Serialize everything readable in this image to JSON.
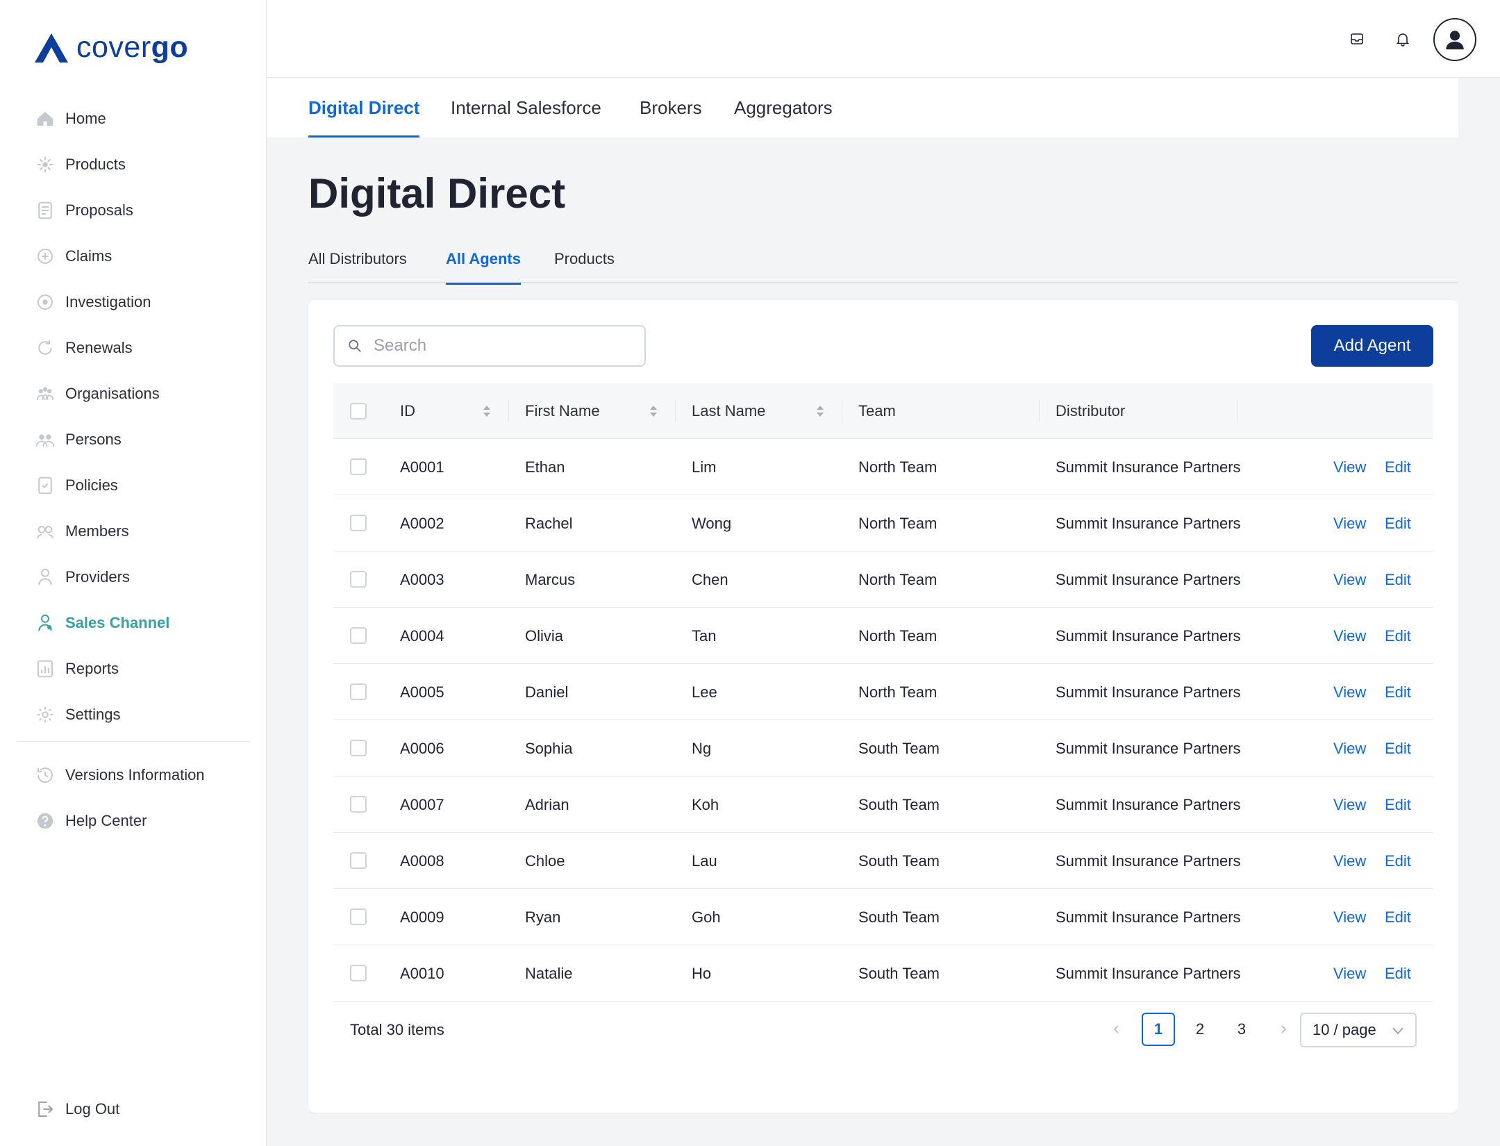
{
  "brand": {
    "name_light": "cover",
    "name_bold": "go"
  },
  "sidebar": {
    "items": [
      {
        "label": "Home",
        "icon": "home-icon"
      },
      {
        "label": "Products",
        "icon": "products-icon"
      },
      {
        "label": "Proposals",
        "icon": "proposals-icon"
      },
      {
        "label": "Claims",
        "icon": "claims-icon"
      },
      {
        "label": "Investigation",
        "icon": "investigation-icon"
      },
      {
        "label": "Renewals",
        "icon": "renewals-icon"
      },
      {
        "label": "Organisations",
        "icon": "organisations-icon"
      },
      {
        "label": "Persons",
        "icon": "persons-icon"
      },
      {
        "label": "Policies",
        "icon": "policies-icon"
      },
      {
        "label": "Members",
        "icon": "members-icon"
      },
      {
        "label": "Providers",
        "icon": "providers-icon"
      },
      {
        "label": "Sales Channel",
        "icon": "sales-channel-icon",
        "active": true
      },
      {
        "label": "Reports",
        "icon": "reports-icon"
      },
      {
        "label": "Settings",
        "icon": "settings-icon"
      }
    ],
    "secondary": [
      {
        "label": "Versions Information",
        "icon": "history-icon"
      },
      {
        "label": "Help Center",
        "icon": "help-icon"
      }
    ],
    "logout": "Log Out"
  },
  "channel_tabs": [
    "Digital Direct",
    "Internal Salesforce",
    "Brokers",
    "Aggregators"
  ],
  "active_channel": "Digital Direct",
  "page": {
    "title": "Digital Direct",
    "subtabs": [
      "All Distributors",
      "All Agents",
      "Products"
    ],
    "active_subtab": "All Agents"
  },
  "search": {
    "placeholder": "Search"
  },
  "add_button": "Add Agent",
  "table": {
    "columns": [
      "ID",
      "First Name",
      "Last Name",
      "Team",
      "Distributor"
    ],
    "row_actions": {
      "view": "View",
      "edit": "Edit"
    },
    "rows": [
      [
        "A0001",
        "Ethan",
        "Lim",
        "North Team",
        "Summit Insurance Partners"
      ],
      [
        "A0002",
        "Rachel",
        "Wong",
        "North Team",
        "Summit Insurance Partners"
      ],
      [
        "A0003",
        "Marcus",
        "Chen",
        "North Team",
        "Summit Insurance Partners"
      ],
      [
        "A0004",
        "Olivia",
        "Tan",
        "North Team",
        "Summit Insurance Partners"
      ],
      [
        "A0005",
        "Daniel",
        "Lee",
        "North Team",
        "Summit Insurance Partners"
      ],
      [
        "A0006",
        "Sophia",
        "Ng",
        "South Team",
        "Summit Insurance Partners"
      ],
      [
        "A0007",
        "Adrian",
        "Koh",
        "South Team",
        "Summit Insurance Partners"
      ],
      [
        "A0008",
        "Chloe",
        "Lau",
        "South Team",
        "Summit Insurance Partners"
      ],
      [
        "A0009",
        "Ryan",
        "Goh",
        "South Team",
        "Summit Insurance Partners"
      ],
      [
        "A0010",
        "Natalie",
        "Ho",
        "South Team",
        "Summit Insurance Partners"
      ]
    ]
  },
  "pagination": {
    "total_text": "Total 30 items",
    "pages": [
      "1",
      "2",
      "3"
    ],
    "current": "1",
    "page_size": "10 / page"
  },
  "colors": {
    "brand": "#0d3e9b",
    "accent": "#1167d4",
    "active_nav": "#3a9fa1"
  }
}
